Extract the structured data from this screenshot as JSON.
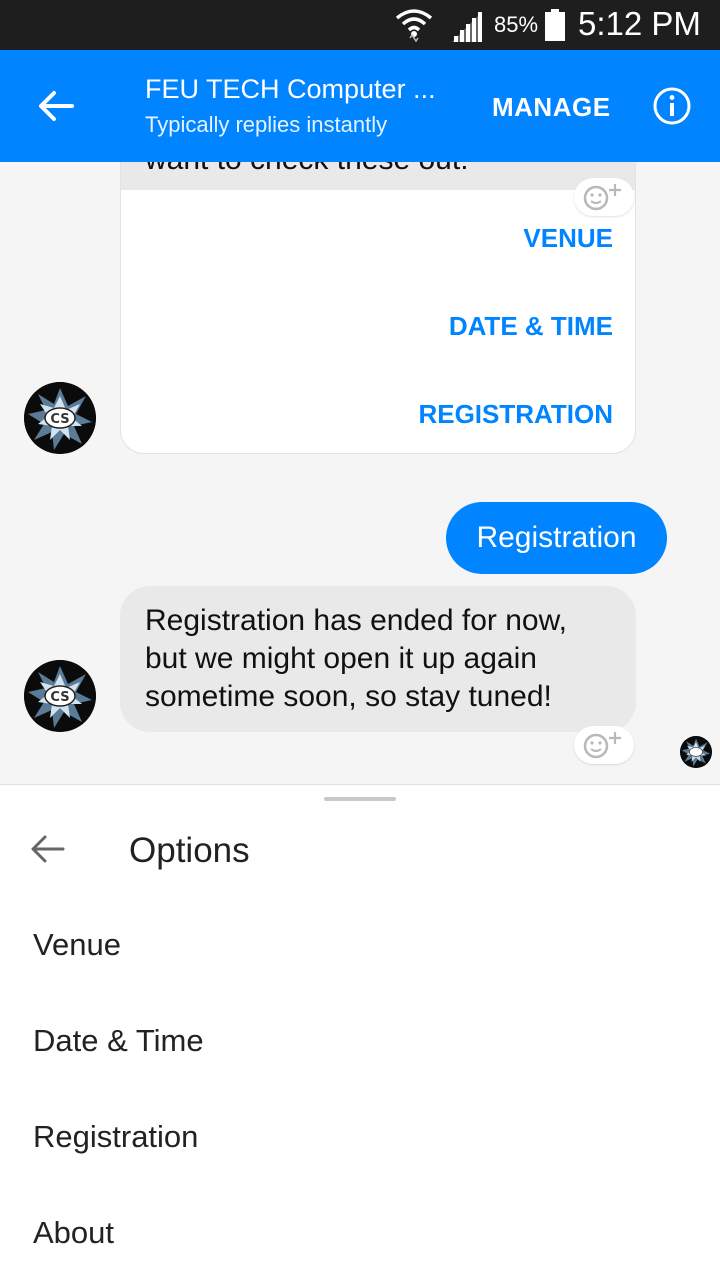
{
  "status_bar": {
    "battery_percent": "85%",
    "time": "5:12 PM",
    "icons": [
      "wifi-icon",
      "signal-icon",
      "battery-icon"
    ]
  },
  "header": {
    "title": "FEU TECH Computer ...",
    "subtitle": "Typically replies instantly",
    "manage_label": "MANAGE",
    "icons": [
      "back-arrow-icon",
      "info-icon"
    ]
  },
  "chat": {
    "card": {
      "partial_text": "want to check these out:",
      "options": [
        "VENUE",
        "DATE & TIME",
        "REGISTRATION"
      ]
    },
    "outgoing_message": "Registration",
    "incoming_message": "Registration has ended for now, but we might open it up again sometime soon, so stay tuned!",
    "avatar_label": "CS"
  },
  "options_sheet": {
    "title": "Options",
    "items": [
      "Venue",
      "Date & Time",
      "Registration",
      "About"
    ]
  },
  "colors": {
    "brand": "#0084ff",
    "status_bar": "#1e1e1e",
    "bubble_in": "#e9e9e9"
  }
}
